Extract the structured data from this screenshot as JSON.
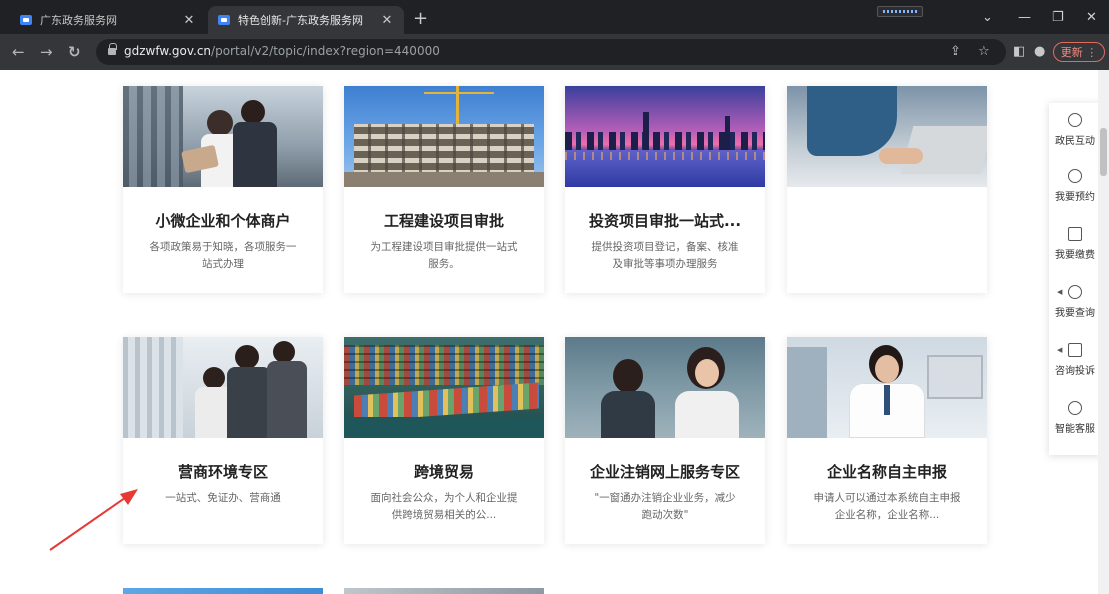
{
  "browser": {
    "tabs": [
      {
        "title": "广东政务服务网",
        "active": false
      },
      {
        "title": "特色创新-广东政务服务网",
        "active": true
      }
    ],
    "new_tab": "+",
    "url_host": "gdzwfw.gov.cn",
    "url_path": "/portal/v2/topic/index?region=440000",
    "update_label": "更新",
    "accent": "#f28b82"
  },
  "cards_row1": [
    {
      "title": "小微企业和个体商户",
      "desc": "各项政策易于知晓，各项服务一站式办理"
    },
    {
      "title": "工程建设项目审批",
      "desc": "为工程建设项目审批提供一站式服务。"
    },
    {
      "title": "投资项目审批一站式...",
      "desc": "提供投资项目登记，备案、核准及审批等事项办理服务"
    },
    {
      "title": "",
      "desc": ""
    }
  ],
  "cards_row2": [
    {
      "title": "营商环境专区",
      "desc": "一站式、免证办、营商通"
    },
    {
      "title": "跨境贸易",
      "desc": "面向社会公众，为个人和企业提供跨境贸易相关的公..."
    },
    {
      "title": "企业注销网上服务专区",
      "desc": "\"一窗通办注销企业业务，减少 跑动次数\""
    },
    {
      "title": "企业名称自主申报",
      "desc": "申请人可以通过本系统自主申报企业名称，企业名称..."
    }
  ],
  "sidebar": [
    {
      "label": "政民互动",
      "icon": "chat-icon"
    },
    {
      "label": "我要预约",
      "icon": "clock-icon"
    },
    {
      "label": "我要缴费",
      "icon": "payment-icon"
    },
    {
      "label": "我要查询",
      "icon": "search-icon"
    },
    {
      "label": "咨询投诉",
      "icon": "message-icon"
    },
    {
      "label": "智能客服",
      "icon": "headset-icon"
    }
  ]
}
